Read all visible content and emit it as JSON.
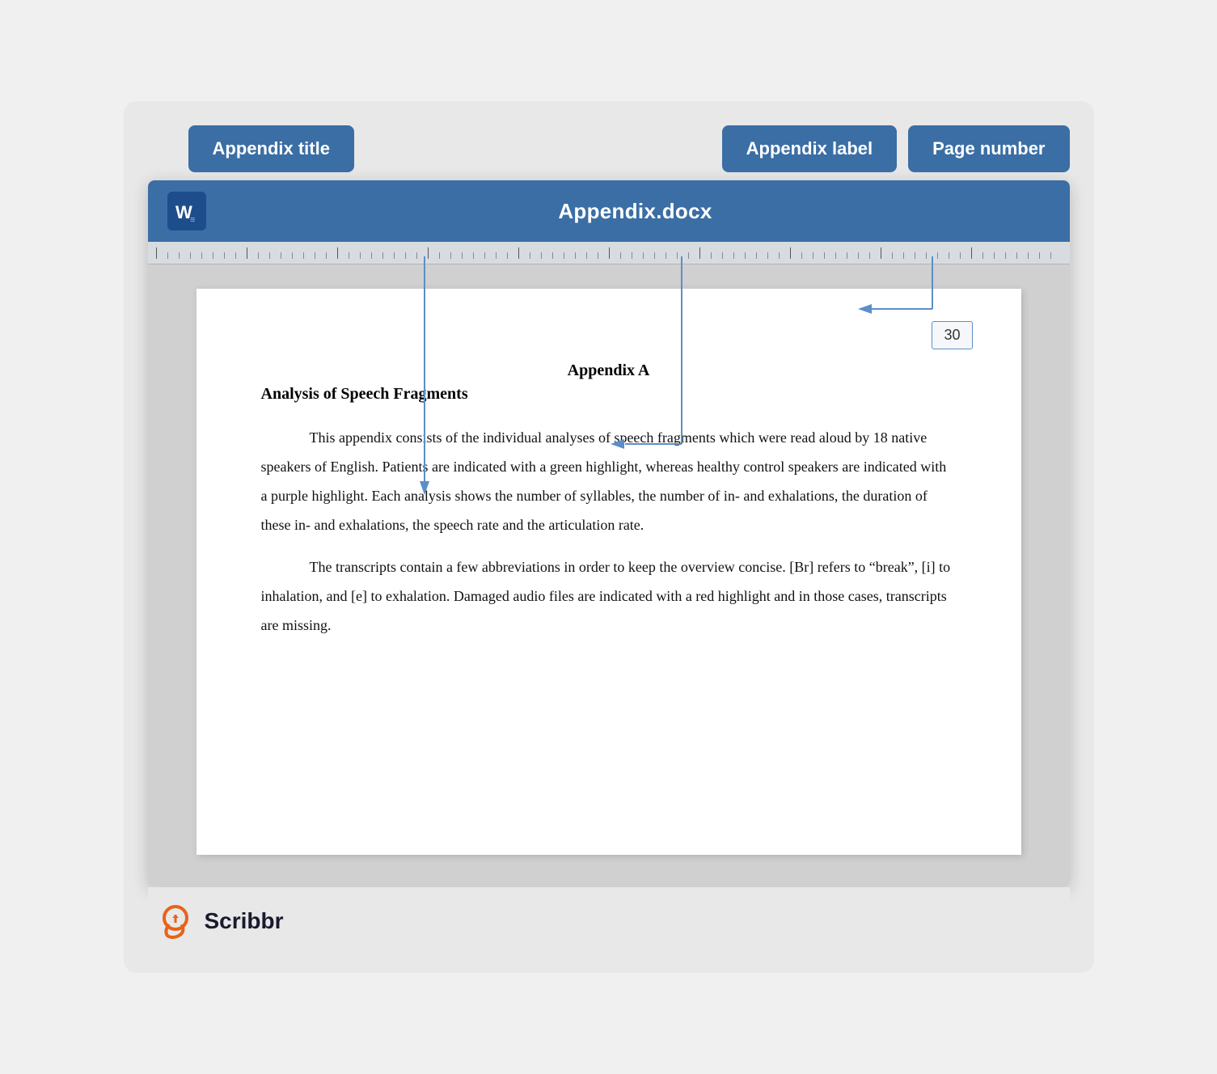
{
  "tooltips": {
    "appendix_title": "Appendix title",
    "appendix_label": "Appendix label",
    "page_number": "Page number"
  },
  "word": {
    "title": "Appendix.docx"
  },
  "document": {
    "page_number": "30",
    "appendix_label": "Appendix A",
    "appendix_title": "Analysis of Speech Fragments",
    "paragraph1": "This appendix consists of the individual analyses of speech fragments which were read aloud by 18 native speakers of English. Patients are indicated with a green highlight, whereas healthy control speakers are indicated with a purple highlight. Each analysis shows the number of syllables, the number of in- and exhalations, the duration of these in- and exhalations, the speech rate and the articulation rate.",
    "paragraph2": "The transcripts contain a few abbreviations in order to keep the overview concise. [Br] refers to “break”, [i] to inhalation, and [e] to exhalation. Damaged audio files are indicated with a red highlight and in those cases, transcripts are missing."
  },
  "footer": {
    "brand": "Scribbr"
  }
}
